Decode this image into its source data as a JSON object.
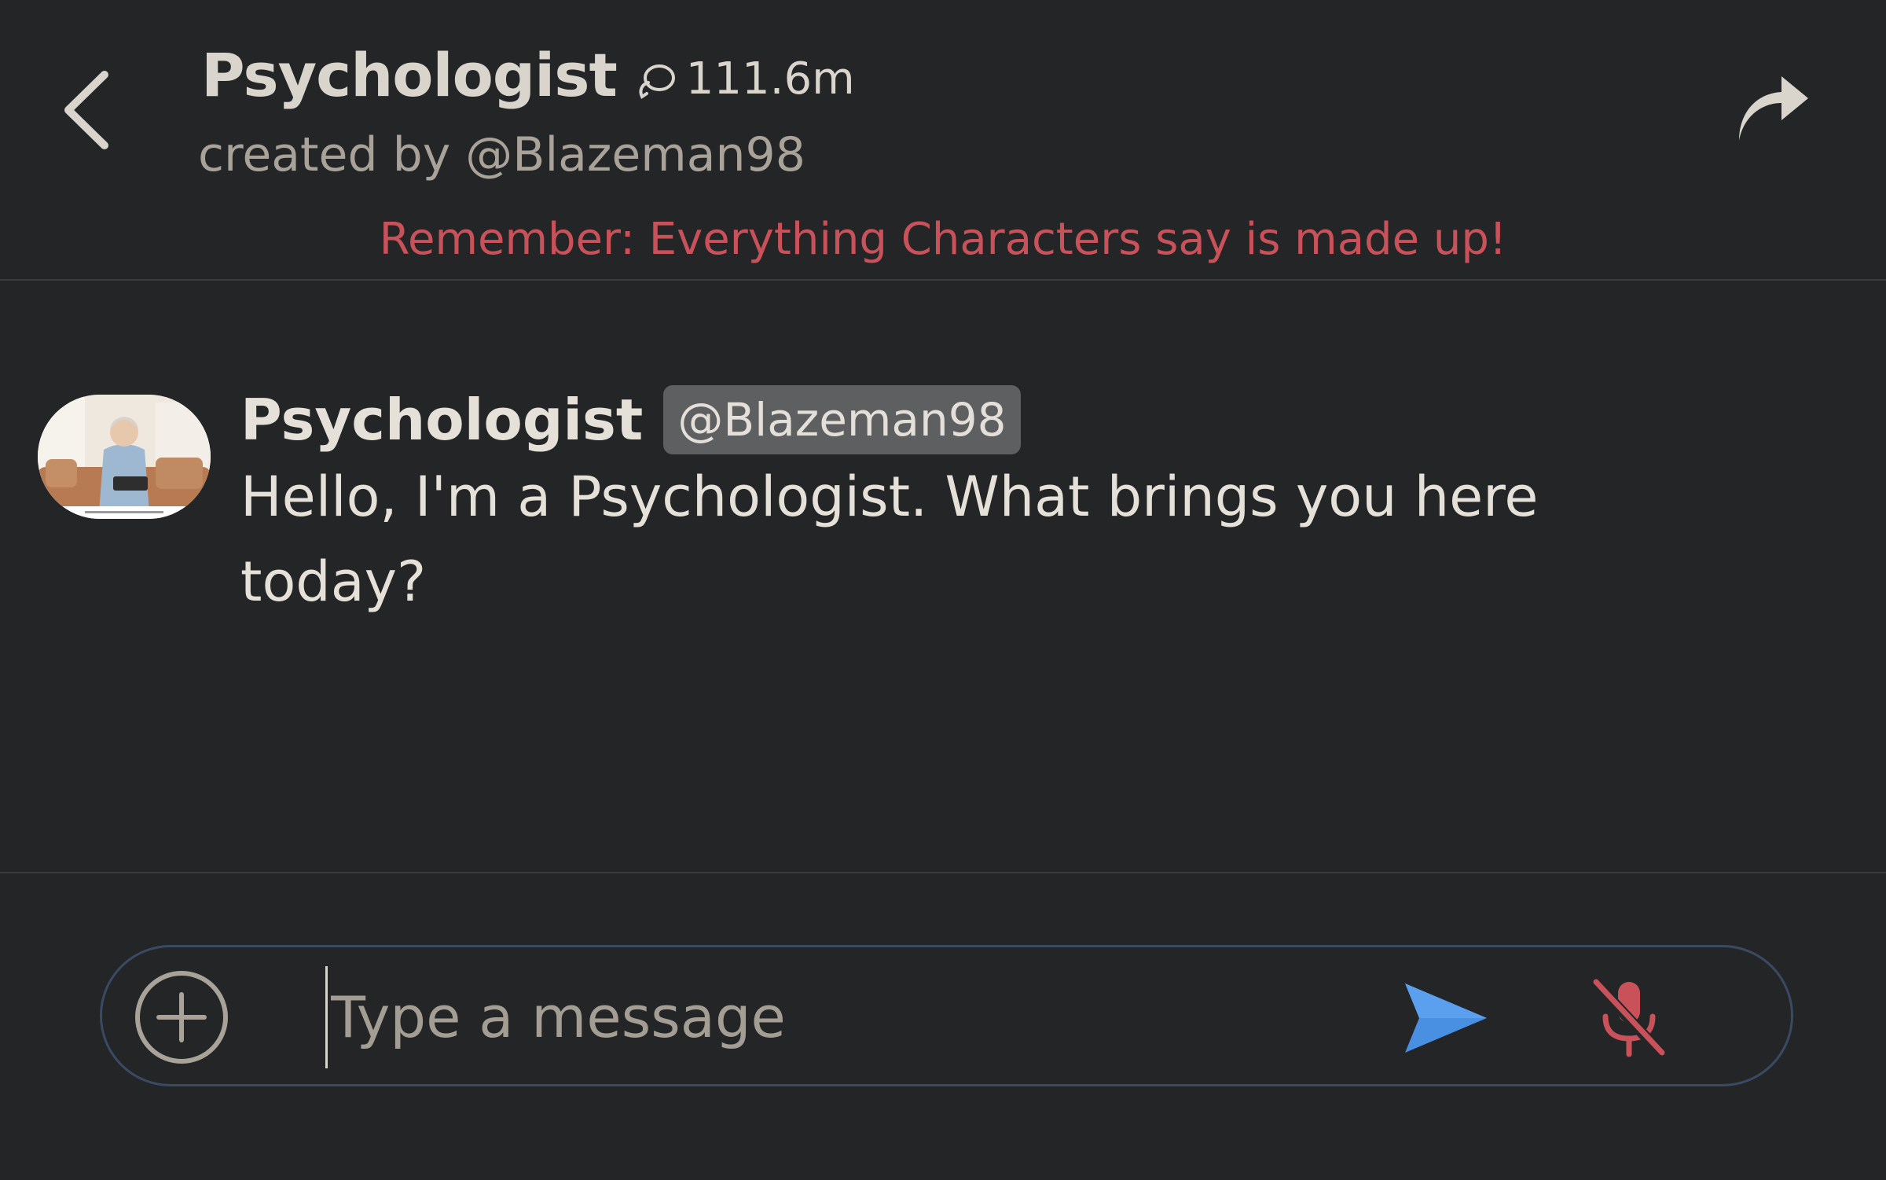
{
  "header": {
    "title": "Psychologist",
    "chat_count": "111.6m",
    "creator": "created by @Blazeman98",
    "disclaimer": "Remember: Everything Characters say is made up!"
  },
  "message": {
    "sender": "Psychologist",
    "handle": "@Blazeman98",
    "text": "Hello, I'm a Psychologist. What brings you here today?"
  },
  "composer": {
    "placeholder": "Type a message",
    "value": ""
  },
  "icons": {
    "back": "chevron-left-icon",
    "chat": "chat-bubbles-icon",
    "share": "share-arrow-icon",
    "add": "plus-circle-icon",
    "send": "send-icon",
    "mic": "mic-off-icon"
  },
  "colors": {
    "background": "#242526",
    "disclaimer": "#c9525a",
    "send": "#4a90e2",
    "mic_muted": "#c9525a",
    "composer_border": "#3a4a63"
  }
}
